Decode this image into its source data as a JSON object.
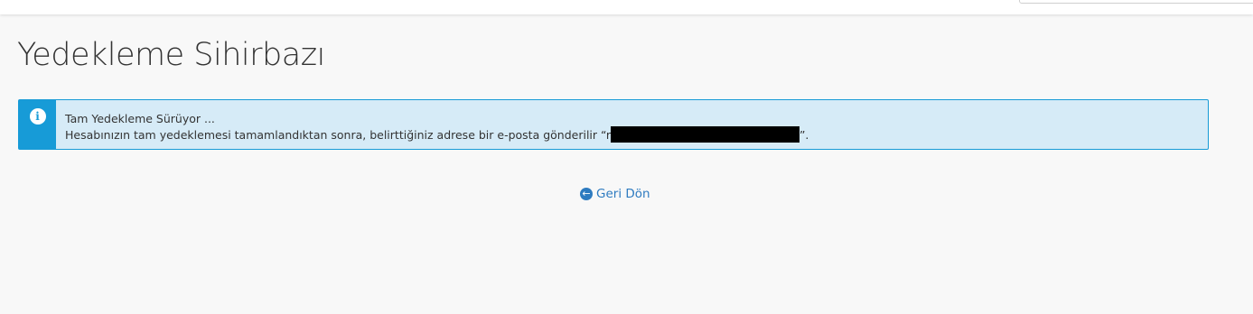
{
  "page": {
    "title": "Yedekleme Sihirbazı"
  },
  "alert": {
    "icon": "info-icon",
    "icon_glyph": "i",
    "heading": "Tam Yedekleme Sürüyor ...",
    "message_prefix": "Hesabınızın tam yedeklemesi tamamlandıktan sonra, belirttiğiniz adrese bir e-posta gönderilir “",
    "email_partial": "r",
    "message_suffix": "”.",
    "accent_color": "#179bd7",
    "background_color": "#d6ebf7"
  },
  "actions": {
    "back_label": "Geri Dön",
    "back_icon": "arrow-circle-left-icon",
    "back_icon_glyph": "←",
    "link_color": "#2e7bc0"
  }
}
